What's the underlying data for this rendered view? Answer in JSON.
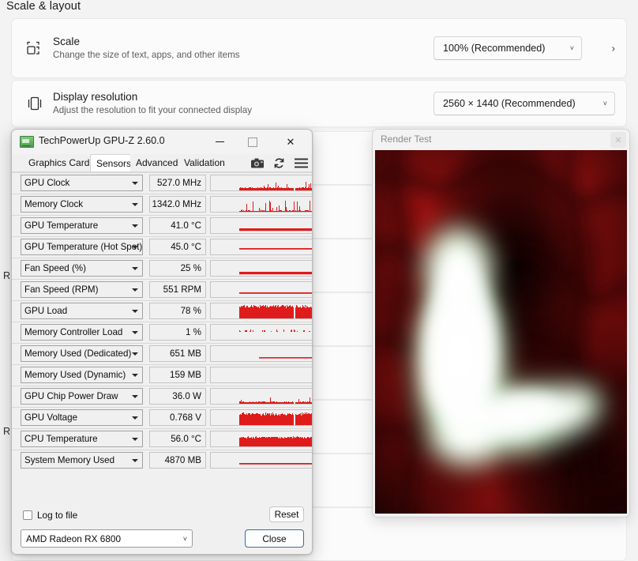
{
  "settings": {
    "section_title": "Scale & layout",
    "cards": [
      {
        "icon": "scale-icon",
        "title": "Scale",
        "subtitle": "Change the size of text, apps, and other items",
        "value": "100% (Recommended)",
        "chevron": "˅",
        "expand_arrow": "›"
      },
      {
        "icon": "display-resolution-icon",
        "title": "Display resolution",
        "subtitle": "Adjust the resolution to fit your connected display",
        "value": "2560 × 1440 (Recommended)",
        "chevron": "˅"
      }
    ],
    "partial_labels": [
      "R",
      "R"
    ]
  },
  "gpuz": {
    "window_title": "TechPowerUp GPU-Z 2.60.0",
    "app_icon": "graphics-card-icon",
    "window_buttons": {
      "minimize": "minimize-icon",
      "maximize": "maximize-icon",
      "close": "✕"
    },
    "tabs": [
      {
        "label": "Graphics Card",
        "active": false
      },
      {
        "label": "Sensors",
        "active": true
      },
      {
        "label": "Advanced",
        "active": false
      },
      {
        "label": "Validation",
        "active": false
      }
    ],
    "toolbar_icons": [
      "camera-icon",
      "refresh-icon",
      "hamburger-menu-icon"
    ],
    "sensors": [
      {
        "name": "GPU Clock",
        "value": "527.0 MHz",
        "graph": "noisy-low",
        "level": 0.3
      },
      {
        "name": "Memory Clock",
        "value": "1342.0 MHz",
        "graph": "spiky",
        "level": 0.22
      },
      {
        "name": "GPU Temperature",
        "value": "41.0 °C",
        "graph": "flat-thick",
        "level": 0.55
      },
      {
        "name": "GPU Temperature (Hot Spot)",
        "value": "45.0 °C",
        "graph": "flat-thin",
        "level": 0.4
      },
      {
        "name": "Fan Speed (%)",
        "value": "25 %",
        "graph": "flat-thick",
        "level": 0.45
      },
      {
        "name": "Fan Speed (RPM)",
        "value": "551 RPM",
        "graph": "flat-thin",
        "level": 0.3
      },
      {
        "name": "GPU Load",
        "value": "78 %",
        "graph": "dense-tall",
        "level": 0.8
      },
      {
        "name": "Memory Controller Load",
        "value": "1 %",
        "graph": "sparse-dots",
        "level": 0.1
      },
      {
        "name": "Memory Used (Dedicated)",
        "value": "651 MB",
        "graph": "flat-line-half",
        "level": 0.25
      },
      {
        "name": "Memory Used (Dynamic)",
        "value": "159 MB",
        "graph": "empty",
        "level": 0.0
      },
      {
        "name": "GPU Chip Power Draw",
        "value": "36.0 W",
        "graph": "noisy-low",
        "level": 0.22
      },
      {
        "name": "GPU Voltage",
        "value": "0.768 V",
        "graph": "dense-tall",
        "level": 0.72
      },
      {
        "name": "CPU Temperature",
        "value": "56.0 °C",
        "graph": "dense-mid",
        "level": 0.6
      },
      {
        "name": "System Memory Used",
        "value": "4870 MB",
        "graph": "flat-thin",
        "level": 0.3
      }
    ],
    "log_to_file": {
      "label": "Log to file",
      "checked": false
    },
    "reset_button": "Reset",
    "device_select": {
      "value": "AMD Radeon RX 6800",
      "chevron": "˅"
    },
    "close_button": "Close",
    "graph_color": "#e01b1b"
  },
  "render_test": {
    "window_title": "Render Test",
    "close_button": "✕",
    "canvas": {
      "description": "dark-red plasma field with bright white-green glow",
      "base_color": "#1a0000",
      "plasma_color": "#7a0d0d",
      "glow_color": "#ffffff",
      "glow_edge_color": "#8ff0b4"
    }
  }
}
